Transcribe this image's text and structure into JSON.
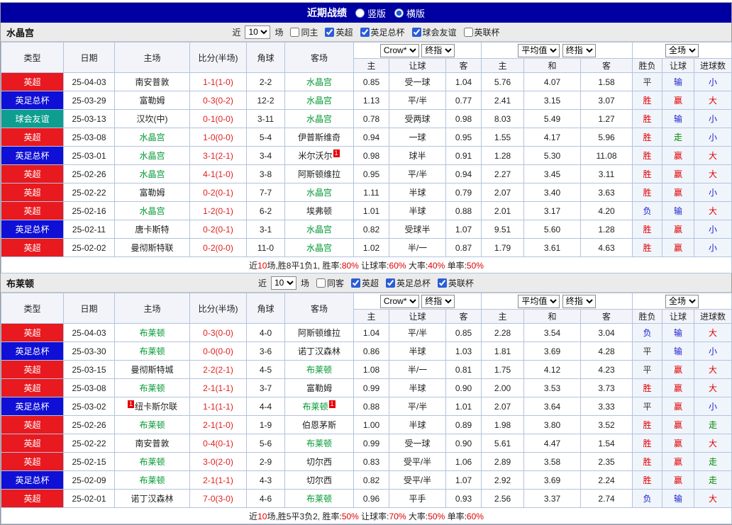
{
  "topbar": {
    "title": "近期战绩",
    "radios": [
      {
        "label": "竖版",
        "checked": false
      },
      {
        "label": "横版",
        "checked": true
      }
    ]
  },
  "selects": {
    "count": "10",
    "bookmaker": "Crow*",
    "final": "终指",
    "average": "平均值",
    "scope": "全场"
  },
  "table_headers": {
    "left": [
      "类型",
      "日期",
      "主场",
      "比分(半场)",
      "角球",
      "客场"
    ],
    "group1": [
      "主",
      "让球",
      "客"
    ],
    "group2": [
      "主",
      "和",
      "客"
    ],
    "group3": [
      "胜负",
      "让球",
      "进球数"
    ]
  },
  "type_colors": {
    "英超": "#e8191f",
    "英足总杯": "#0f0fd6",
    "球会友谊": "#0d9e8f"
  },
  "result_colors": {
    "胜": "#e00000",
    "负": "#2020cc",
    "平": "#333333",
    "赢": "#e00000",
    "输": "#2020cc",
    "走": "#008800",
    "大": "#e00000",
    "小": "#2020cc"
  },
  "sections": [
    {
      "team": "水晶宫",
      "filter": {
        "prefix": "近",
        "suffix": "场",
        "same": {
          "label": "同主",
          "checked": false
        },
        "leagues": [
          {
            "label": "英超",
            "checked": true
          },
          {
            "label": "英足总杯",
            "checked": true
          },
          {
            "label": "球会友谊",
            "checked": true
          },
          {
            "label": "英联杯",
            "checked": false
          }
        ]
      },
      "rows": [
        {
          "type": "英超",
          "date": "25-04-03",
          "home": "南安普敦",
          "score": "1-1(1-0)",
          "corners": "2-2",
          "away": "水晶宫",
          "awayFocus": true,
          "oddsHome": "0.85",
          "handicap": "受一球",
          "oddsAway": "1.04",
          "avgHome": "5.76",
          "avgDraw": "4.07",
          "avgAway": "1.58",
          "resWL": "平",
          "resHcap": "输",
          "resGoals": "小"
        },
        {
          "type": "英足总杯",
          "date": "25-03-29",
          "home": "富勒姆",
          "score": "0-3(0-2)",
          "corners": "12-2",
          "away": "水晶宫",
          "awayFocus": true,
          "oddsHome": "1.13",
          "handicap": "平/半",
          "oddsAway": "0.77",
          "avgHome": "2.41",
          "avgDraw": "3.15",
          "avgAway": "3.07",
          "resWL": "胜",
          "resHcap": "赢",
          "resGoals": "大"
        },
        {
          "type": "球会友谊",
          "date": "25-03-13",
          "home": "汉坎(中)",
          "score": "0-1(0-0)",
          "corners": "3-11",
          "away": "水晶宫",
          "awayFocus": true,
          "oddsHome": "0.78",
          "handicap": "受两球",
          "oddsAway": "0.98",
          "avgHome": "8.03",
          "avgDraw": "5.49",
          "avgAway": "1.27",
          "resWL": "胜",
          "resHcap": "输",
          "resGoals": "小"
        },
        {
          "type": "英超",
          "date": "25-03-08",
          "home": "水晶宫",
          "homeFocus": true,
          "score": "1-0(0-0)",
          "corners": "5-4",
          "away": "伊普斯维奇",
          "oddsHome": "0.94",
          "handicap": "一球",
          "oddsAway": "0.95",
          "avgHome": "1.55",
          "avgDraw": "4.17",
          "avgAway": "5.96",
          "resWL": "胜",
          "resHcap": "走",
          "resGoals": "小"
        },
        {
          "type": "英足总杯",
          "date": "25-03-01",
          "home": "水晶宫",
          "homeFocus": true,
          "score": "3-1(2-1)",
          "corners": "3-4",
          "away": "米尔沃尔",
          "awayCard": "1",
          "oddsHome": "0.98",
          "handicap": "球半",
          "oddsAway": "0.91",
          "avgHome": "1.28",
          "avgDraw": "5.30",
          "avgAway": "11.08",
          "resWL": "胜",
          "resHcap": "赢",
          "resGoals": "大"
        },
        {
          "type": "英超",
          "date": "25-02-26",
          "home": "水晶宫",
          "homeFocus": true,
          "score": "4-1(1-0)",
          "corners": "3-8",
          "away": "阿斯顿维拉",
          "oddsHome": "0.95",
          "handicap": "平/半",
          "oddsAway": "0.94",
          "avgHome": "2.27",
          "avgDraw": "3.45",
          "avgAway": "3.11",
          "resWL": "胜",
          "resHcap": "赢",
          "resGoals": "大"
        },
        {
          "type": "英超",
          "date": "25-02-22",
          "home": "富勒姆",
          "score": "0-2(0-1)",
          "corners": "7-7",
          "away": "水晶宫",
          "awayFocus": true,
          "oddsHome": "1.11",
          "handicap": "半球",
          "oddsAway": "0.79",
          "avgHome": "2.07",
          "avgDraw": "3.40",
          "avgAway": "3.63",
          "resWL": "胜",
          "resHcap": "赢",
          "resGoals": "小"
        },
        {
          "type": "英超",
          "date": "25-02-16",
          "home": "水晶宫",
          "homeFocus": true,
          "score": "1-2(0-1)",
          "corners": "6-2",
          "away": "埃弗顿",
          "oddsHome": "1.01",
          "handicap": "半球",
          "oddsAway": "0.88",
          "avgHome": "2.01",
          "avgDraw": "3.17",
          "avgAway": "4.20",
          "resWL": "负",
          "resHcap": "输",
          "resGoals": "大"
        },
        {
          "type": "英足总杯",
          "date": "25-02-11",
          "home": "唐卡斯特",
          "score": "0-2(0-1)",
          "corners": "3-1",
          "away": "水晶宫",
          "awayFocus": true,
          "oddsHome": "0.82",
          "handicap": "受球半",
          "oddsAway": "1.07",
          "avgHome": "9.51",
          "avgDraw": "5.60",
          "avgAway": "1.28",
          "resWL": "胜",
          "resHcap": "赢",
          "resGoals": "小"
        },
        {
          "type": "英超",
          "date": "25-02-02",
          "home": "曼彻斯特联",
          "score": "0-2(0-0)",
          "corners": "11-0",
          "away": "水晶宫",
          "awayFocus": true,
          "oddsHome": "1.02",
          "handicap": "半/一",
          "oddsAway": "0.87",
          "avgHome": "1.79",
          "avgDraw": "3.61",
          "avgAway": "4.63",
          "resWL": "胜",
          "resHcap": "赢",
          "resGoals": "小"
        }
      ],
      "summary": [
        {
          "t": "近"
        },
        {
          "t": "10",
          "red": true
        },
        {
          "t": "场,胜8平1负1, 胜率:"
        },
        {
          "t": "80%",
          "red": true
        },
        {
          "t": " 让球率:"
        },
        {
          "t": "60%",
          "red": true
        },
        {
          "t": " 大率:"
        },
        {
          "t": "40%",
          "red": true
        },
        {
          "t": " 单率:"
        },
        {
          "t": "50%",
          "red": true
        }
      ]
    },
    {
      "team": "布莱顿",
      "filter": {
        "prefix": "近",
        "suffix": "场",
        "same": {
          "label": "同客",
          "checked": false
        },
        "leagues": [
          {
            "label": "英超",
            "checked": true
          },
          {
            "label": "英足总杯",
            "checked": true
          },
          {
            "label": "英联杯",
            "checked": true
          }
        ]
      },
      "rows": [
        {
          "type": "英超",
          "date": "25-04-03",
          "home": "布莱顿",
          "homeFocus": true,
          "score": "0-3(0-0)",
          "corners": "4-0",
          "away": "阿斯顿维拉",
          "oddsHome": "1.04",
          "handicap": "平/半",
          "oddsAway": "0.85",
          "avgHome": "2.28",
          "avgDraw": "3.54",
          "avgAway": "3.04",
          "resWL": "负",
          "resHcap": "输",
          "resGoals": "大"
        },
        {
          "type": "英足总杯",
          "date": "25-03-30",
          "home": "布莱顿",
          "homeFocus": true,
          "score": "0-0(0-0)",
          "corners": "3-6",
          "away": "诺丁汉森林",
          "oddsHome": "0.86",
          "handicap": "半球",
          "oddsAway": "1.03",
          "avgHome": "1.81",
          "avgDraw": "3.69",
          "avgAway": "4.28",
          "resWL": "平",
          "resHcap": "输",
          "resGoals": "小"
        },
        {
          "type": "英超",
          "date": "25-03-15",
          "home": "曼彻斯特城",
          "score": "2-2(2-1)",
          "corners": "4-5",
          "away": "布莱顿",
          "awayFocus": true,
          "oddsHome": "1.08",
          "handicap": "半/一",
          "oddsAway": "0.81",
          "avgHome": "1.75",
          "avgDraw": "4.12",
          "avgAway": "4.23",
          "resWL": "平",
          "resHcap": "赢",
          "resGoals": "大"
        },
        {
          "type": "英超",
          "date": "25-03-08",
          "home": "布莱顿",
          "homeFocus": true,
          "score": "2-1(1-1)",
          "corners": "3-7",
          "away": "富勒姆",
          "oddsHome": "0.99",
          "handicap": "半球",
          "oddsAway": "0.90",
          "avgHome": "2.00",
          "avgDraw": "3.53",
          "avgAway": "3.73",
          "resWL": "胜",
          "resHcap": "赢",
          "resGoals": "大"
        },
        {
          "type": "英足总杯",
          "date": "25-03-02",
          "home": "纽卡斯尔联",
          "homeCardPre": "1",
          "score": "1-1(1-1)",
          "corners": "4-4",
          "away": "布莱顿",
          "awayFocus": true,
          "awayCard": "1",
          "oddsHome": "0.88",
          "handicap": "平/半",
          "oddsAway": "1.01",
          "avgHome": "2.07",
          "avgDraw": "3.64",
          "avgAway": "3.33",
          "resWL": "平",
          "resHcap": "赢",
          "resGoals": "小"
        },
        {
          "type": "英超",
          "date": "25-02-26",
          "home": "布莱顿",
          "homeFocus": true,
          "score": "2-1(1-0)",
          "corners": "1-9",
          "away": "伯恩茅斯",
          "oddsHome": "1.00",
          "handicap": "半球",
          "oddsAway": "0.89",
          "avgHome": "1.98",
          "avgDraw": "3.80",
          "avgAway": "3.52",
          "resWL": "胜",
          "resHcap": "赢",
          "resGoals": "走"
        },
        {
          "type": "英超",
          "date": "25-02-22",
          "home": "南安普敦",
          "score": "0-4(0-1)",
          "corners": "5-6",
          "away": "布莱顿",
          "awayFocus": true,
          "oddsHome": "0.99",
          "handicap": "受一球",
          "oddsAway": "0.90",
          "avgHome": "5.61",
          "avgDraw": "4.47",
          "avgAway": "1.54",
          "resWL": "胜",
          "resHcap": "赢",
          "resGoals": "大"
        },
        {
          "type": "英超",
          "date": "25-02-15",
          "home": "布莱顿",
          "homeFocus": true,
          "score": "3-0(2-0)",
          "corners": "2-9",
          "away": "切尔西",
          "oddsHome": "0.83",
          "handicap": "受平/半",
          "oddsAway": "1.06",
          "avgHome": "2.89",
          "avgDraw": "3.58",
          "avgAway": "2.35",
          "resWL": "胜",
          "resHcap": "赢",
          "resGoals": "走"
        },
        {
          "type": "英足总杯",
          "date": "25-02-09",
          "home": "布莱顿",
          "homeFocus": true,
          "score": "2-1(1-1)",
          "corners": "4-3",
          "away": "切尔西",
          "oddsHome": "0.82",
          "handicap": "受平/半",
          "oddsAway": "1.07",
          "avgHome": "2.92",
          "avgDraw": "3.69",
          "avgAway": "2.24",
          "resWL": "胜",
          "resHcap": "赢",
          "resGoals": "走"
        },
        {
          "type": "英超",
          "date": "25-02-01",
          "home": "诺丁汉森林",
          "score": "7-0(3-0)",
          "corners": "4-6",
          "away": "布莱顿",
          "awayFocus": true,
          "oddsHome": "0.96",
          "handicap": "平手",
          "oddsAway": "0.93",
          "avgHome": "2.56",
          "avgDraw": "3.37",
          "avgAway": "2.74",
          "resWL": "负",
          "resHcap": "输",
          "resGoals": "大"
        }
      ],
      "summary": [
        {
          "t": "近"
        },
        {
          "t": "10",
          "red": true
        },
        {
          "t": "场,胜5平3负2, 胜率:"
        },
        {
          "t": "50%",
          "red": true
        },
        {
          "t": " 让球率:"
        },
        {
          "t": "70%",
          "red": true
        },
        {
          "t": " 大率:"
        },
        {
          "t": "50%",
          "red": true
        },
        {
          "t": " 单率:"
        },
        {
          "t": "60%",
          "red": true
        }
      ]
    }
  ]
}
